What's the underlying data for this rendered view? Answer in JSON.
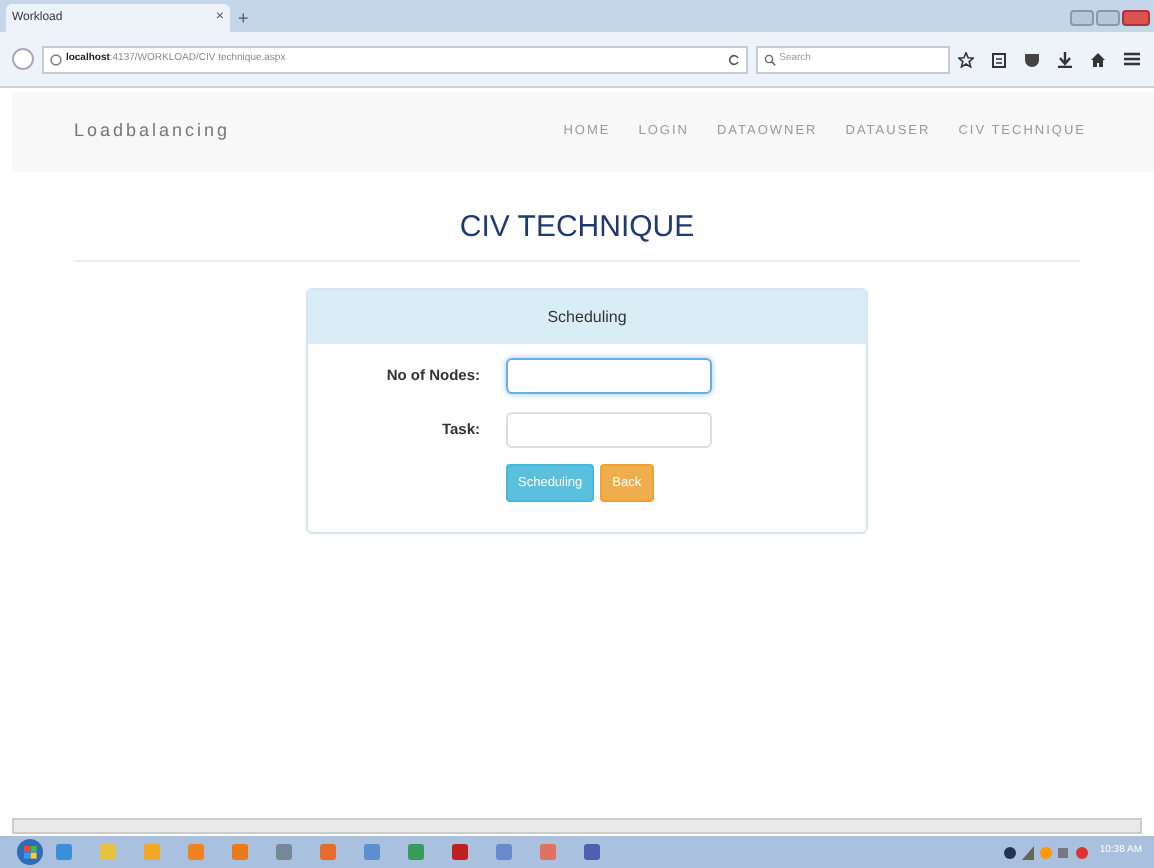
{
  "browser": {
    "tab_title": "Workload",
    "new_tab": "+",
    "close_tab": "×",
    "address": {
      "host": "localhost",
      "path": ":4137/WORKLOAD/CIV technique.aspx"
    },
    "search": {
      "placeholder": "Search"
    }
  },
  "navbar": {
    "brand": "Loadbalancing",
    "links": [
      {
        "label": "HOME"
      },
      {
        "label": "LOGIN"
      },
      {
        "label": "DATAOWNER"
      },
      {
        "label": "DATAUSER"
      },
      {
        "label": "CIV TECHNIQUE"
      }
    ]
  },
  "page_title": "CIV TECHNIQUE",
  "panel": {
    "heading": "Scheduling",
    "fields": [
      {
        "label": "No of Nodes:",
        "focused": true
      },
      {
        "label": "Task:",
        "focused": false
      }
    ],
    "buttons": [
      {
        "label": "Scheduling",
        "kind": "info"
      },
      {
        "label": "Back",
        "kind": "warning"
      }
    ]
  },
  "taskbar": {
    "clock": "10:38 AM"
  }
}
